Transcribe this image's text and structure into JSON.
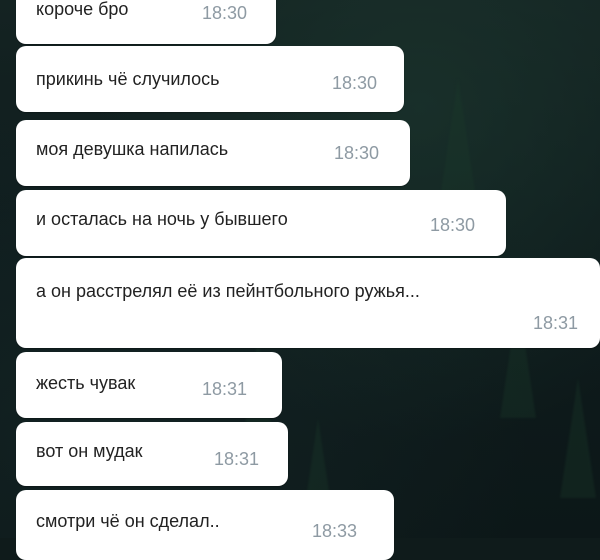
{
  "messages": [
    {
      "text": "короче бро",
      "time": "18:30"
    },
    {
      "text": "прикинь чё случилось",
      "time": "18:30"
    },
    {
      "text": "моя девушка напилась",
      "time": "18:30"
    },
    {
      "text": "и осталась на ночь у бывшего",
      "time": "18:30"
    },
    {
      "text": "а он расстрелял её из пейнтбольного ружья...",
      "time": "18:31"
    },
    {
      "text": "жесть чувак",
      "time": "18:31"
    },
    {
      "text": "вот он мудак",
      "time": "18:31"
    },
    {
      "text": "смотри чё он сделал..",
      "time": "18:33"
    }
  ],
  "colors": {
    "bubble": "#ffffff",
    "text": "#222222",
    "time": "#8e9aa3",
    "background": "#0f1b1b"
  }
}
